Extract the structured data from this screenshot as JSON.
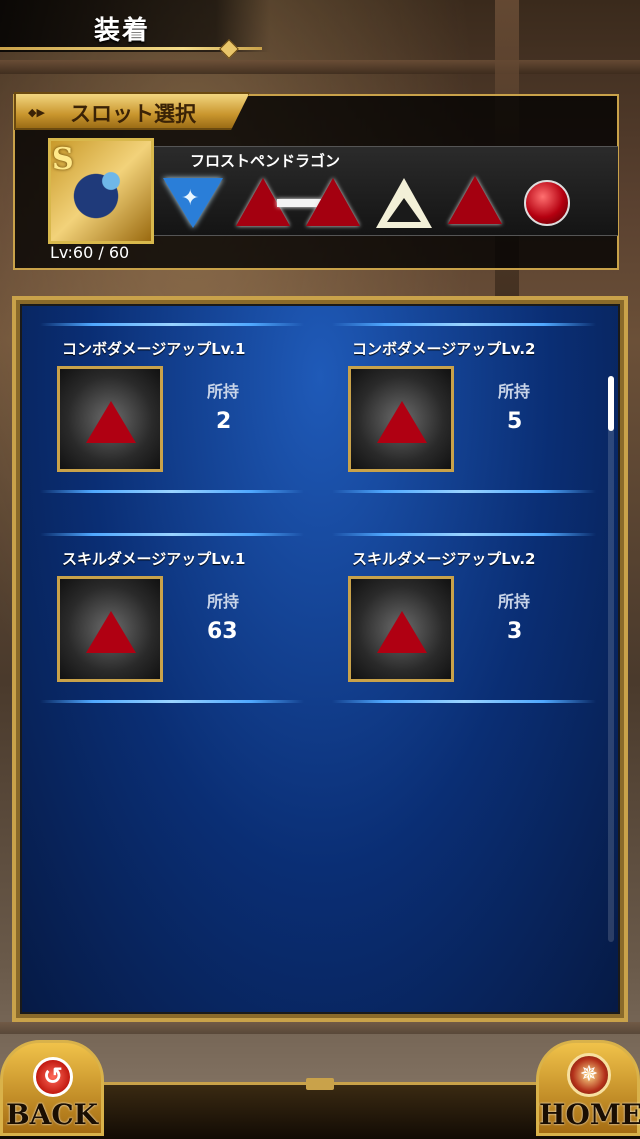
{
  "header": {
    "title": "装着"
  },
  "slot_panel": {
    "tab_label": "スロット選択",
    "character": {
      "rank": "S",
      "name": "フロストペンドラゴン",
      "level_label": "Lv:",
      "level_current": "60",
      "level_separator": "/",
      "level_max": "60"
    },
    "slots": [
      {
        "icon": "blue-star-gem-icon",
        "color": "#2a7ed8"
      },
      {
        "icon": "red-triangle-gem-icon",
        "color": "#a40010"
      },
      {
        "icon": "red-triangle-gem-icon",
        "color": "#a40010"
      },
      {
        "icon": "empty-triangle-slot-icon",
        "color": "#f3f0d8"
      },
      {
        "icon": "red-diamond-gem-icon",
        "color": "#a40010"
      },
      {
        "icon": "red-orb-gem-icon",
        "color": "#b50010"
      }
    ]
  },
  "items": [
    {
      "name": "コンボダメージアップLv.1",
      "own_label": "所持",
      "count": "2"
    },
    {
      "name": "コンボダメージアップLv.2",
      "own_label": "所持",
      "count": "5"
    },
    {
      "name": "スキルダメージアップLv.1",
      "own_label": "所持",
      "count": "63"
    },
    {
      "name": "スキルダメージアップLv.2",
      "own_label": "所持",
      "count": "3"
    }
  ],
  "nav": {
    "back_label": "BACK",
    "home_label": "HOME"
  },
  "colors": {
    "gold": "#c9a24a",
    "panel_blue": "#0a2e74",
    "gem_red": "#b00012"
  }
}
